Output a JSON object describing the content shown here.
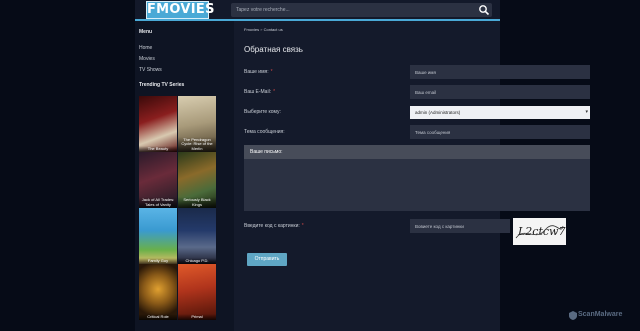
{
  "header": {
    "logo": "FMOVIES",
    "search_placeholder": "Tapez votre recherche..."
  },
  "sidebar": {
    "menu_title": "Menu",
    "menu_items": [
      {
        "label": "Home"
      },
      {
        "label": "Movies"
      },
      {
        "label": "TV Shows"
      }
    ],
    "trending_title": "Trending TV Series",
    "posters": [
      {
        "title": "The Beauty",
        "color": "#8a1e1e"
      },
      {
        "title": "The Pendragon Cycle: Rise of the Merlin",
        "color": "#c9b58a"
      },
      {
        "title": "Jack of All Trades: Tales of Vanity",
        "color": "#6a2b3a"
      },
      {
        "title": "Seriously Black Kings",
        "color": "#4a6b3a"
      },
      {
        "title": "Family Guy",
        "color": "#3a9ad0"
      },
      {
        "title": "Chicago P.D.",
        "color": "#243a6a"
      },
      {
        "title": "Critical Role",
        "color": "#3a2410"
      },
      {
        "title": "Primal",
        "color": "#b0341c"
      }
    ]
  },
  "breadcrumb": {
    "home": "Fmovies",
    "separator": "»",
    "current": "Contact us"
  },
  "page_title": "Обратная связь",
  "form": {
    "name_label": "Ваше имя:",
    "name_placeholder": "Ваше имя",
    "email_label": "Ваш E-Mail:",
    "email_placeholder": "Ваш email",
    "recipient_label": "Выберите кому:",
    "recipient_value": "admin (Administrators)",
    "subject_label": "Тема сообщения:",
    "subject_placeholder": "Тема сообщения",
    "message_label": "Ваше письмо:",
    "captcha_label": "Введите код с картинки:",
    "captcha_placeholder": "Вовиете код с картинки",
    "captcha_text": "L2ctcw7",
    "required_mark": "*",
    "submit_label": "Отправить"
  },
  "watermark": "ScanMalware",
  "colors": {
    "accent": "#4aa9d6",
    "button": "#5fa6c4",
    "background": "#060b17"
  }
}
